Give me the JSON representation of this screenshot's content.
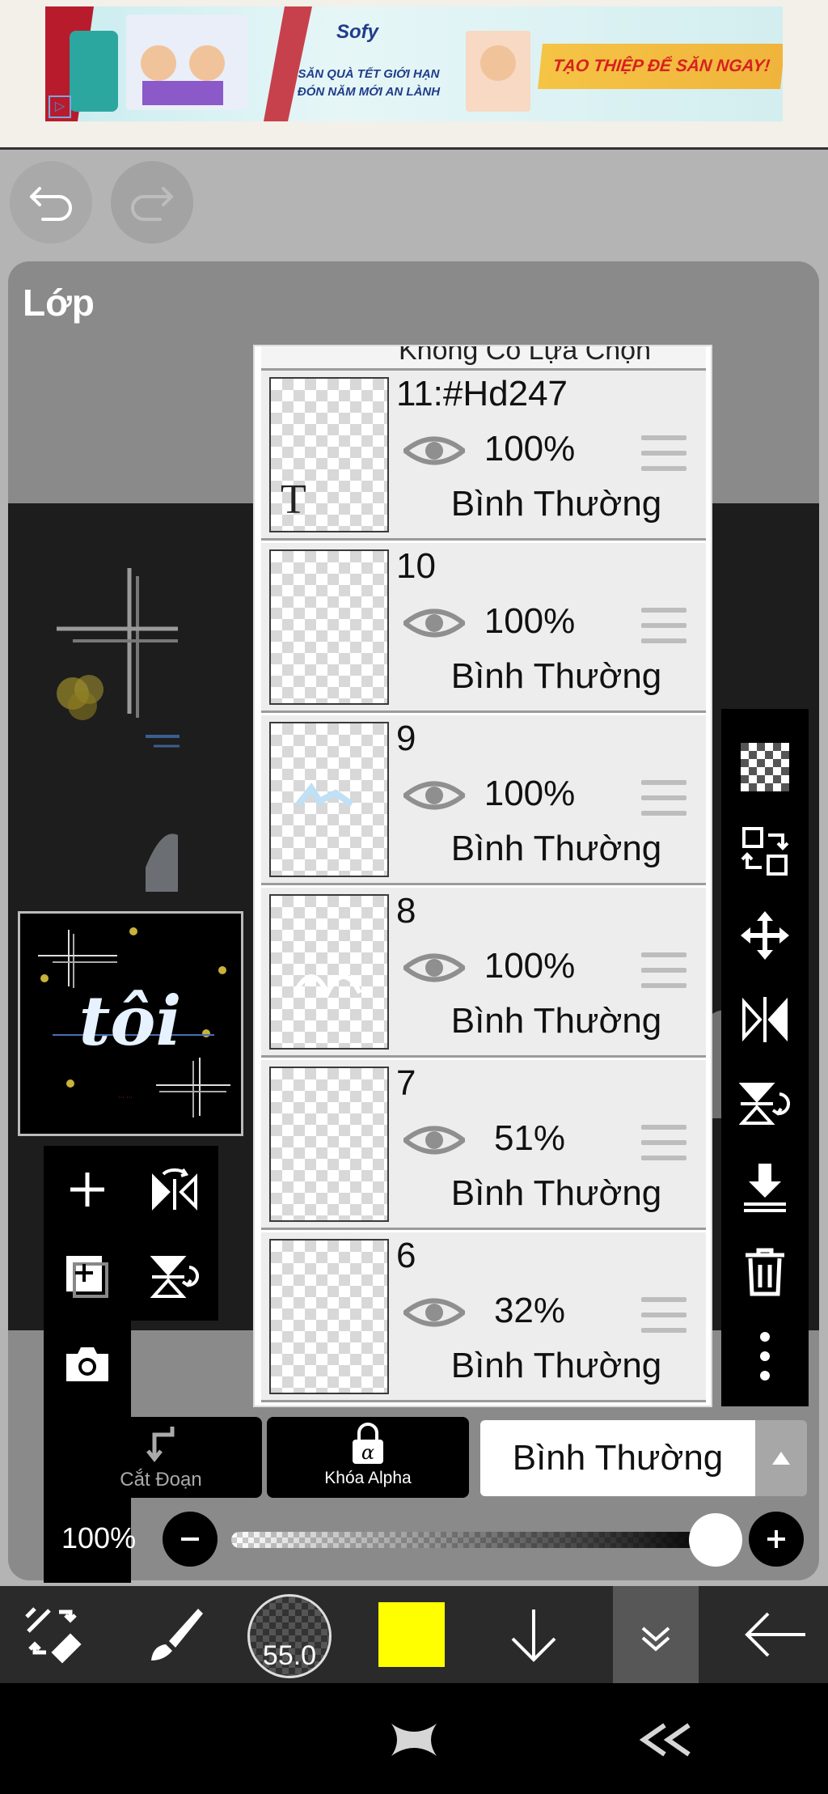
{
  "ad": {
    "brand": "Sofy",
    "line1": "SĂN QUÀ TẾT GIỚI HẠN",
    "line2": "ĐÓN NĂM MỚI AN LÀNH",
    "cta": "TẠO THIỆP ĐỂ SĂN NGAY!",
    "adchoices_icon": "ad-choices-icon"
  },
  "panel": {
    "title": "Lớp",
    "partial_top_label": "Không Có Lựa Chọn"
  },
  "layers": [
    {
      "name": "11:#Hd247",
      "opacity": "100%",
      "blend": "Bình Thường"
    },
    {
      "name": "10",
      "opacity": "100%",
      "blend": "Bình Thường"
    },
    {
      "name": "9",
      "opacity": "100%",
      "blend": "Bình Thường"
    },
    {
      "name": "8",
      "opacity": "100%",
      "blend": "Bình Thường"
    },
    {
      "name": "7",
      "opacity": "51%",
      "blend": "Bình Thường"
    },
    {
      "name": "6",
      "opacity": "32%",
      "blend": "Bình Thường"
    }
  ],
  "preview_text": "tôi",
  "controls": {
    "clip_label": "Cắt Đoạn",
    "alpha_lock_label": "Khóa Alpha",
    "blend_mode": "Bình Thường",
    "opacity_label": "100%",
    "opacity_value": 1.0
  },
  "toolbar": {
    "brush_size": "55.0",
    "color": "#ffff00"
  },
  "icons": {
    "undo": "undo-icon",
    "redo": "redo-icon",
    "visibility": "eye-icon",
    "drag": "drag-handle-icon",
    "checker": "transparency-icon",
    "transform": "transform-icon",
    "move": "move-icon",
    "flip": "flip-icon",
    "rotate": "rotate-icon",
    "merge_down": "merge-down-icon",
    "delete": "trash-icon",
    "more": "more-icon",
    "add": "add-layer-icon",
    "duplicate": "duplicate-icon",
    "camera": "camera-icon"
  }
}
